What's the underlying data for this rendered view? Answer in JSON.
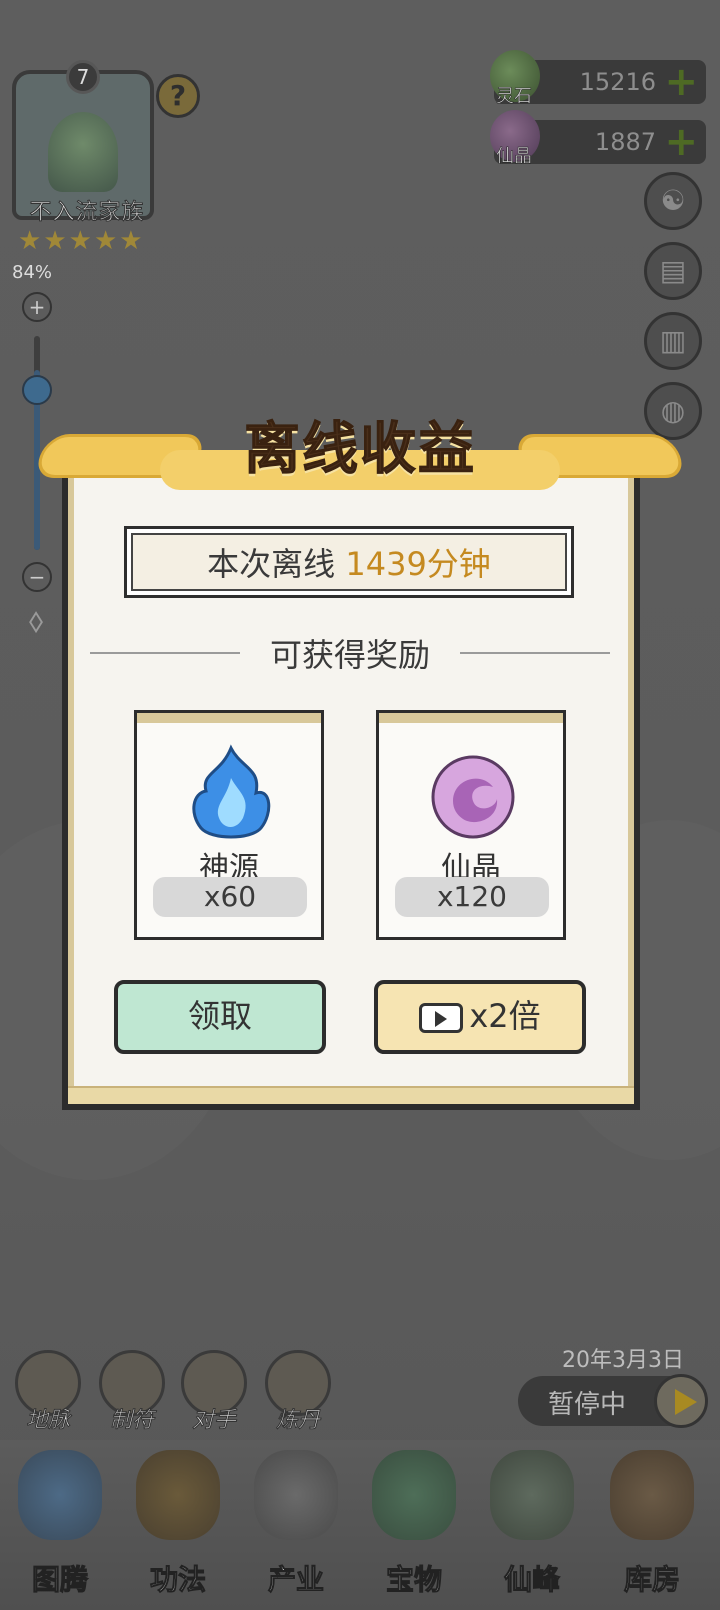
{
  "family": {
    "level": "7",
    "name": "不入流家族",
    "stars": 5,
    "help_label": "?"
  },
  "zoom": {
    "percent_label": "84%",
    "level": 0.84,
    "plus": "+",
    "minus": "−"
  },
  "currencies": [
    {
      "label": "灵石",
      "value": "15216",
      "plus": "+",
      "icon": "spirit-stone-icon"
    },
    {
      "label": "仙晶",
      "value": "1887",
      "plus": "+",
      "icon": "immortal-crystal-icon"
    }
  ],
  "side_buttons": [
    "settings-icon",
    "scroll-icon",
    "book-icon",
    "pouch-icon",
    "card-icon",
    "map-icon"
  ],
  "modal": {
    "title": "离线收益",
    "offline_prefix": "本次离线 ",
    "offline_duration": "1439分钟",
    "rewards_heading": "可获得奖励",
    "rewards": [
      {
        "name": "神源",
        "qty": "x60",
        "icon": "blue-flame-icon"
      },
      {
        "name": "仙晶",
        "qty": "x120",
        "icon": "purple-crystal-icon"
      }
    ],
    "claim_label": "领取",
    "double_label": "x2倍"
  },
  "bottom": {
    "date": "20年3月3日",
    "pause_label": "暂停中",
    "quick_actions": [
      "地脉",
      "制符",
      "对手",
      "炼丹"
    ],
    "nav": [
      "图腾",
      "功法",
      "产业",
      "宝物",
      "仙峰",
      "库房"
    ]
  },
  "colors": {
    "accent_gold": "#c58a20",
    "claim_bg": "#bfe7d2",
    "double_bg": "#f6e4b2"
  }
}
